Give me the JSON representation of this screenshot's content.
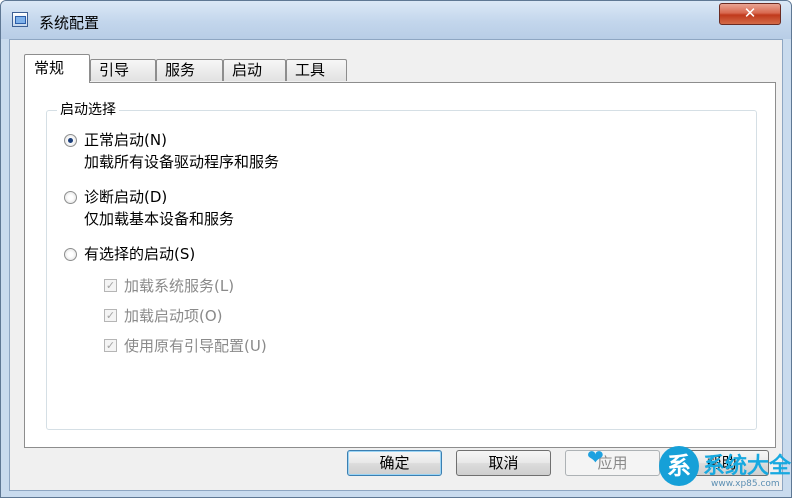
{
  "window": {
    "title": "系统配置",
    "close_glyph": "✕",
    "icon": "msconfig-icon"
  },
  "tabs": [
    {
      "label": "常规",
      "active": true
    },
    {
      "label": "引导",
      "active": false
    },
    {
      "label": "服务",
      "active": false
    },
    {
      "label": "启动",
      "active": false
    },
    {
      "label": "工具",
      "active": false
    }
  ],
  "startup_selection": {
    "legend": "启动选择",
    "options": [
      {
        "label": "正常启动(N)",
        "description": "加载所有设备驱动程序和服务",
        "checked": true
      },
      {
        "label": "诊断启动(D)",
        "description": "仅加载基本设备和服务",
        "checked": false
      },
      {
        "label": "有选择的启动(S)",
        "description": "",
        "checked": false
      }
    ],
    "selective_items": [
      {
        "label": "加载系统服务(L)",
        "checked": true,
        "enabled": false
      },
      {
        "label": "加载启动项(O)",
        "checked": true,
        "enabled": false
      },
      {
        "label": "使用原有引导配置(U)",
        "checked": true,
        "enabled": false
      }
    ]
  },
  "buttons": {
    "ok": "确定",
    "cancel": "取消",
    "apply": "应用",
    "help": "帮助"
  },
  "watermark": {
    "logo_char": "系",
    "text": "系统大全",
    "site": "www.xp85.com"
  },
  "colors": {
    "titlebar": "#c3d6ec",
    "close_button": "#c0391c",
    "default_button_border": "#3c7fb1",
    "watermark": "#17a9e0"
  }
}
